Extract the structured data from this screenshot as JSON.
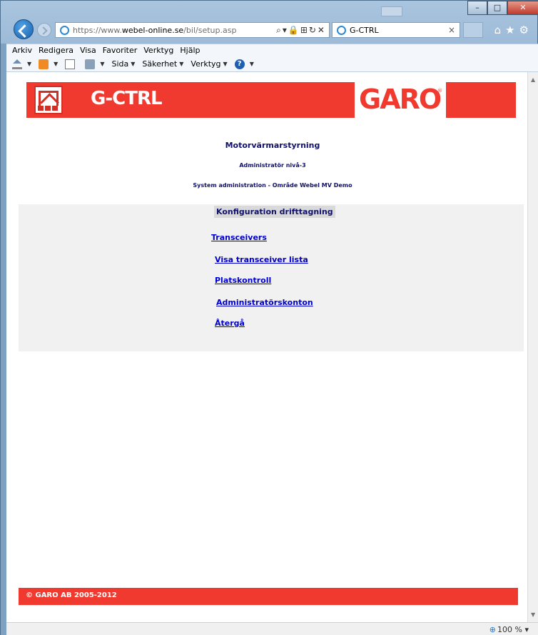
{
  "browser": {
    "url_prefix": "https://www.",
    "url_host": "webel-online.se",
    "url_path": "/bil/setup.asp",
    "tab_title": "G-CTRL",
    "zoom": "100 %"
  },
  "menu": {
    "items": [
      "Arkiv",
      "Redigera",
      "Visa",
      "Favoriter",
      "Verktyg",
      "Hjälp"
    ]
  },
  "commandbar": {
    "sida": "Sida",
    "sakerhet": "Säkerhet",
    "verktyg": "Verktyg"
  },
  "page": {
    "brand": "G-CTRL",
    "company": "GARO",
    "title": "Motorvärmarstyrning",
    "level": "Administratör nivå-3",
    "area": "System administration - Område Webel MV Demo",
    "section": "Konfiguration drifttagning",
    "links": [
      "Transceivers",
      "Visa transceiver lista",
      "Platskontroll",
      "Administratörskonton",
      "Återgå"
    ],
    "footer": "© GARO AB 2005-2012"
  },
  "colors": {
    "brand_red": "#f03a2f",
    "heading_navy": "#11116a",
    "link_blue": "#0000cc"
  }
}
